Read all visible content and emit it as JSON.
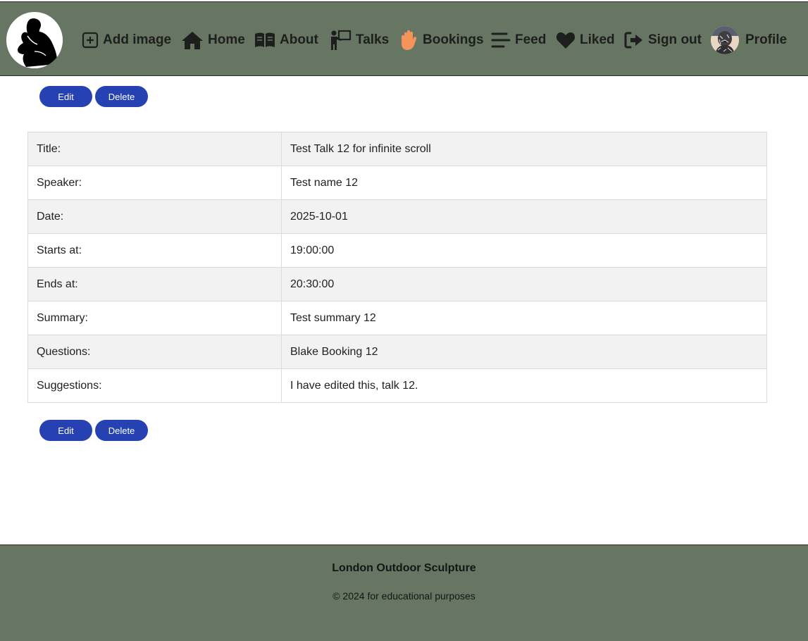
{
  "nav": {
    "items": [
      {
        "label": "Add image",
        "icon": "plus-square-icon"
      },
      {
        "label": "Home",
        "icon": "home-icon"
      },
      {
        "label": "About",
        "icon": "open-book-icon"
      },
      {
        "label": "Talks",
        "icon": "presenter-icon"
      },
      {
        "label": "Bookings",
        "icon": "raised-hand-icon"
      },
      {
        "label": "Feed",
        "icon": "stream-lines-icon"
      },
      {
        "label": "Liked",
        "icon": "heart-icon"
      },
      {
        "label": "Sign out",
        "icon": "sign-out-icon"
      },
      {
        "label": "Profile",
        "icon": "avatar-image"
      }
    ]
  },
  "actions": {
    "edit_label": "Edit",
    "delete_label": "Delete"
  },
  "talk": {
    "rows": [
      {
        "label": "Title:",
        "value": "Test Talk 12 for infinite scroll"
      },
      {
        "label": "Speaker:",
        "value": "Test name 12"
      },
      {
        "label": "Date:",
        "value": "2025-10-01"
      },
      {
        "label": "Starts at:",
        "value": "19:00:00"
      },
      {
        "label": "Ends at:",
        "value": "20:30:00"
      },
      {
        "label": "Summary:",
        "value": "Test summary 12"
      },
      {
        "label": "Questions:",
        "value": "Blake Booking 12"
      },
      {
        "label": "Suggestions:",
        "value": "I have edited this, talk 12."
      }
    ]
  },
  "footer": {
    "site_name": "London Outdoor Sculpture",
    "copyright": "© 2024 for educational purposes"
  },
  "colors": {
    "navbar_bg": "#667663",
    "button_bg": "#2541b2",
    "bookings_icon": "#f4935a"
  }
}
